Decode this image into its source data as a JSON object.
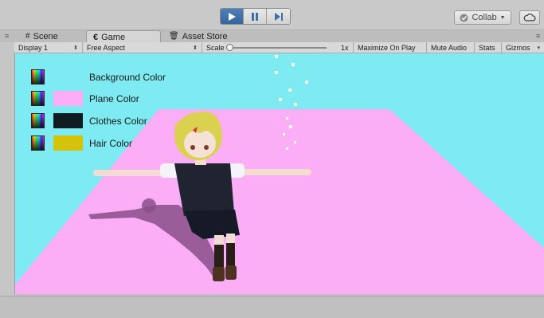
{
  "toolbar": {
    "play_label": "Play",
    "pause_label": "Pause",
    "step_label": "Step",
    "collab_label": "Collab",
    "accent_color": "#3f6fa8"
  },
  "tabs": [
    {
      "label": "Scene",
      "icon": "grid-icon",
      "active": false
    },
    {
      "label": "Game",
      "icon": "pacman-icon",
      "active": true
    },
    {
      "label": "Asset Store",
      "icon": "bag-icon",
      "active": false
    }
  ],
  "game_controls": {
    "display": "Display 1",
    "aspect": "Free Aspect",
    "scale_label": "Scale",
    "scale_value": "1x",
    "maximize": "Maximize On Play",
    "mute": "Mute Audio",
    "stats": "Stats",
    "gizmos": "Gizmos"
  },
  "color_panel": {
    "items": [
      {
        "label": "Background Color",
        "swatch": null
      },
      {
        "label": "Plane Color",
        "swatch": "#fbadf6"
      },
      {
        "label": "Clothes Color",
        "swatch": "#0d1d22"
      },
      {
        "label": "Hair Color",
        "swatch": "#d4c30a"
      }
    ]
  },
  "scene": {
    "background_color": "#7eebf3",
    "plane_color": "#fbadf6",
    "hair_color": "#d9d14f",
    "clothes_color": "#1f2430"
  }
}
